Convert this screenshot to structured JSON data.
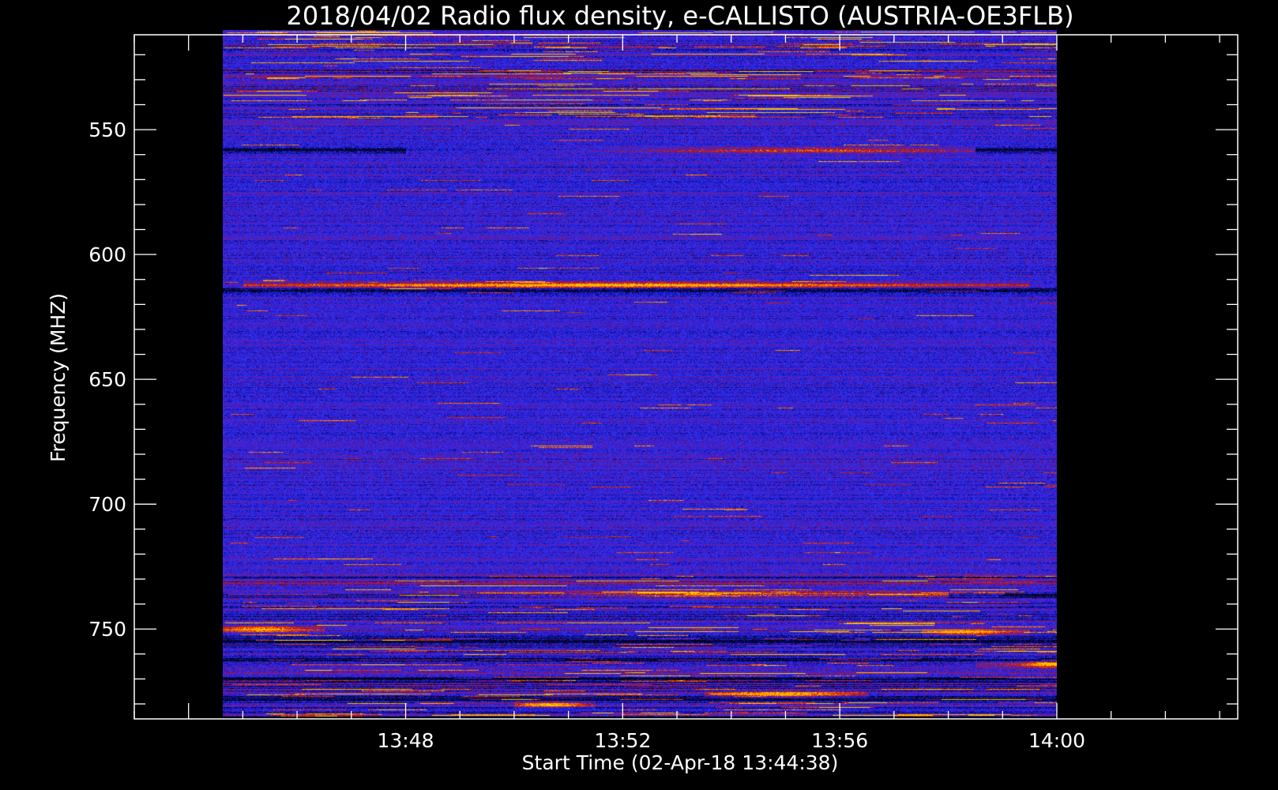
{
  "chart_data": {
    "type": "heatmap",
    "title": "2018/04/02  Radio flux density, e-CALLISTO (AUSTRIA-OE3FLB)",
    "xlabel": "Start Time (02-Apr-18 13:44:38)",
    "ylabel": "Frequency (MHZ)",
    "x_unit": "time",
    "x_range": [
      "13:44:38",
      "14:00:00"
    ],
    "xlim": [
      "13:43:00",
      "14:03:20"
    ],
    "x_ticks": [
      "13:48",
      "13:52",
      "13:56",
      "14:00"
    ],
    "y_range": [
      510,
      785
    ],
    "ylim": [
      512,
      786
    ],
    "y_ticks": [
      550,
      600,
      650,
      700,
      750
    ],
    "y_inverted": true,
    "colormap": [
      "#000000",
      "#0a0a8c",
      "#2020d8",
      "#3535f5",
      "#6010a0",
      "#b01818",
      "#e03000",
      "#ff6a00",
      "#ffc800"
    ],
    "bright_bands_mhz": [
      {
        "freq": 558,
        "from": "13:48:00",
        "to": "13:58:30",
        "peak": "13:55:30"
      },
      {
        "freq": 612,
        "from": "13:45:00",
        "to": "13:59:30",
        "peak": "13:51:30"
      },
      {
        "freq": 736,
        "from": "13:44:38",
        "to": "13:58:00",
        "peak": "13:54:20"
      },
      {
        "freq": 750,
        "from": "13:44:38",
        "to": "13:46:30",
        "peak": "13:45:20"
      },
      {
        "freq": 751,
        "from": "13:57:30",
        "to": "13:59:30",
        "peak": "13:58:20"
      },
      {
        "freq": 764,
        "from": "13:58:30",
        "to": "14:00:00",
        "peak": "13:59:50"
      },
      {
        "freq": 776,
        "from": "13:53:30",
        "to": "13:56:30",
        "peak": "13:55:00"
      },
      {
        "freq": 780,
        "from": "13:50:00",
        "to": "13:51:30",
        "peak": "13:50:40"
      }
    ],
    "dark_bands_mhz": [
      558,
      614,
      736,
      755,
      762,
      770,
      778
    ],
    "grid": false,
    "legend": "none"
  }
}
